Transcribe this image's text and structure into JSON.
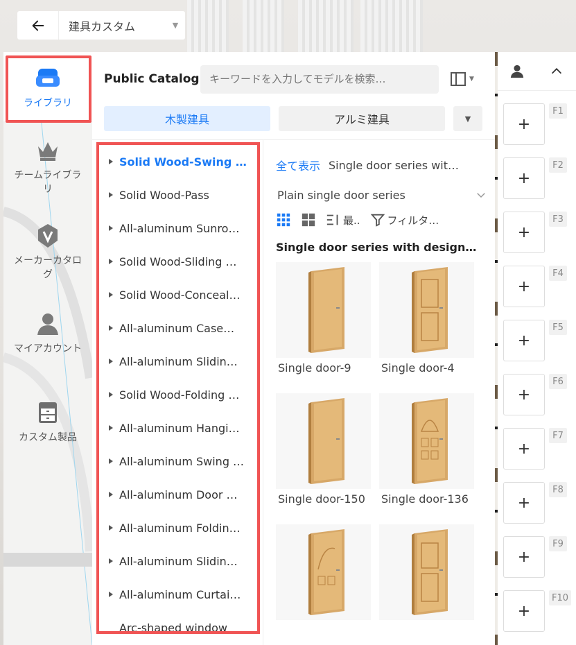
{
  "topbar": {
    "title": "建具カスタム"
  },
  "nav": {
    "items": [
      {
        "label": "ライブラリ",
        "icon": "sofa-icon",
        "active": true
      },
      {
        "label": "チームライブラリ",
        "icon": "crown-icon"
      },
      {
        "label": "メーカーカタログ",
        "icon": "vendor-badge-icon"
      },
      {
        "label": "マイアカウント",
        "icon": "user-icon"
      },
      {
        "label": "カスタム製品",
        "icon": "cabinet-icon"
      }
    ]
  },
  "catalog": {
    "title": "Public Catalog",
    "search_placeholder": "キーワードを入力してモデルを検索…",
    "tabs": [
      "木製建具",
      "アルミ建具"
    ],
    "categories": [
      "Solid Wood-Swing d…",
      "Solid Wood-Pass",
      "All-aluminum Sunro…",
      "Solid Wood-Sliding …",
      "Solid Wood-Conceal…",
      "All-aluminum Case…",
      "All-aluminum Slidin…",
      "Solid Wood-Folding …",
      "All-aluminum Hangi…",
      "All-aluminum Swing …",
      "All-aluminum Door …",
      "All-aluminum Foldin…",
      "All-aluminum Slidin…",
      "All-aluminum Curtai…",
      "Arc-shaped window"
    ],
    "active_category": 0
  },
  "products": {
    "show_all": "全て表示",
    "breadcrumb_current": "Single door series wit…",
    "series": "Plain single door series",
    "sort_label": "最..",
    "filter_label": "フィルタ…",
    "section_title": "Single door series with design…",
    "items": [
      {
        "name": "Single door-9"
      },
      {
        "name": "Single door-4"
      },
      {
        "name": "Single door-150"
      },
      {
        "name": "Single door-136"
      },
      {
        "name": ""
      },
      {
        "name": ""
      }
    ],
    "accent": "#1b7af5"
  },
  "hotkeys": [
    "F1",
    "F2",
    "F3",
    "F4",
    "F5",
    "F6",
    "F7",
    "F8",
    "F9",
    "F10"
  ]
}
